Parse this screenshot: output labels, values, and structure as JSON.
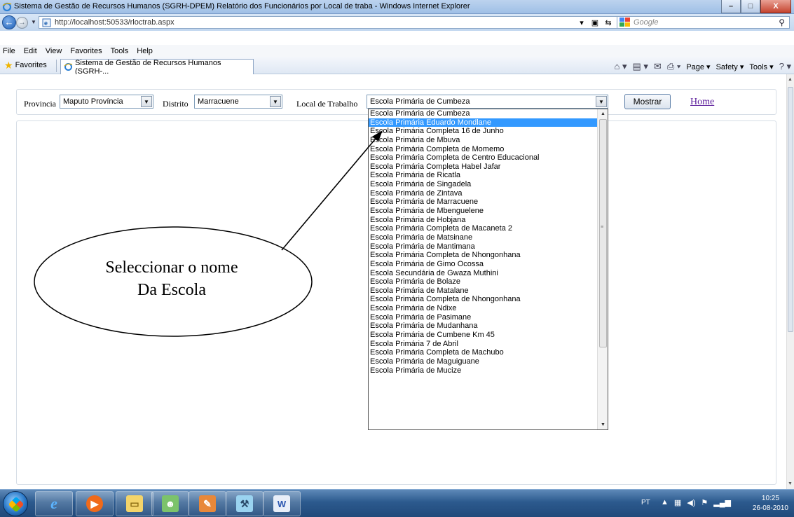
{
  "window": {
    "title": "Sistema de Gestão de Recursos Humanos (SGRH-DPEM) Relatório dos Funcionários por Local de traba - Windows Internet Explorer",
    "minimize": "–",
    "maximize": "□",
    "close": "X"
  },
  "address": {
    "url": "http://localhost:50533/rloctrab.aspx",
    "search_placeholder": "Google"
  },
  "menu": [
    "File",
    "Edit",
    "View",
    "Favorites",
    "Tools",
    "Help"
  ],
  "favorites": {
    "label": "Favorites",
    "tab_title": "Sistema de Gestão de Recursos Humanos (SGRH-..."
  },
  "commands": {
    "page": "Page ▾",
    "safety": "Safety ▾",
    "tools": "Tools ▾"
  },
  "form": {
    "provincia_label": "Provincia",
    "provincia_value": "Maputo Província",
    "distrito_label": "Distrito",
    "distrito_value": "Marracuene",
    "local_label": "Local de Trabalho",
    "local_value": "Escola Primária de Cumbeza",
    "mostrar_button": "Mostrar",
    "home_link": "Home"
  },
  "dropdown": {
    "selected_index": 1,
    "options": [
      "Escola Primária de Cumbeza",
      "Escola Primária Eduardo Mondlane",
      "Escola Primária Completa 16 de Junho",
      "Escola Primária de Mbuva",
      "Escola Primária Completa de Momemo",
      "Escola Primária Completa de Centro Educacional",
      "Escola Primária Completa Habel Jafar",
      "Escola Primária de Ricatla",
      "Escola Primária de Singadela",
      "Escola Primária de Zintava",
      "Escola Primária de Marracuene",
      "Escola Primária de Mbenguelene",
      "Escola Primária de Hobjana",
      "Escola Primária Completa de Macaneta 2",
      "Escola Primária de Matsinane",
      "Escola Primária de Mantimana",
      "Escola Primária Completa de Nhongonhana",
      "Escola Primária de Gimo Ocossa",
      "Escola Secundária de Gwaza Muthini",
      "Escola Primária de Bolaze",
      "Escola Primária de Matalane",
      "Escola Primária Completa de Nhongonhana",
      "Escola Primária de Ndixe",
      "Escola Primária de Pasimane",
      "Escola Primária de Mudanhana",
      "Escola Primária de Cumbene Km 45",
      "Escola Primária 7 de Abril",
      "Escola Primária Completa de Machubo",
      "Escola Primária de Maguiguane",
      "Escola Primária de Mucize"
    ]
  },
  "annotation": {
    "line1": "Seleccionar o nome",
    "line2": "Da Escola"
  },
  "taskbar": {
    "apps": [
      "internet-explorer-icon",
      "media-player-icon",
      "file-explorer-icon",
      "people-icon",
      "paint-icon",
      "tools-icon",
      "word-icon"
    ],
    "language": "PT",
    "time": "10:25",
    "date": "26-08-2010"
  }
}
